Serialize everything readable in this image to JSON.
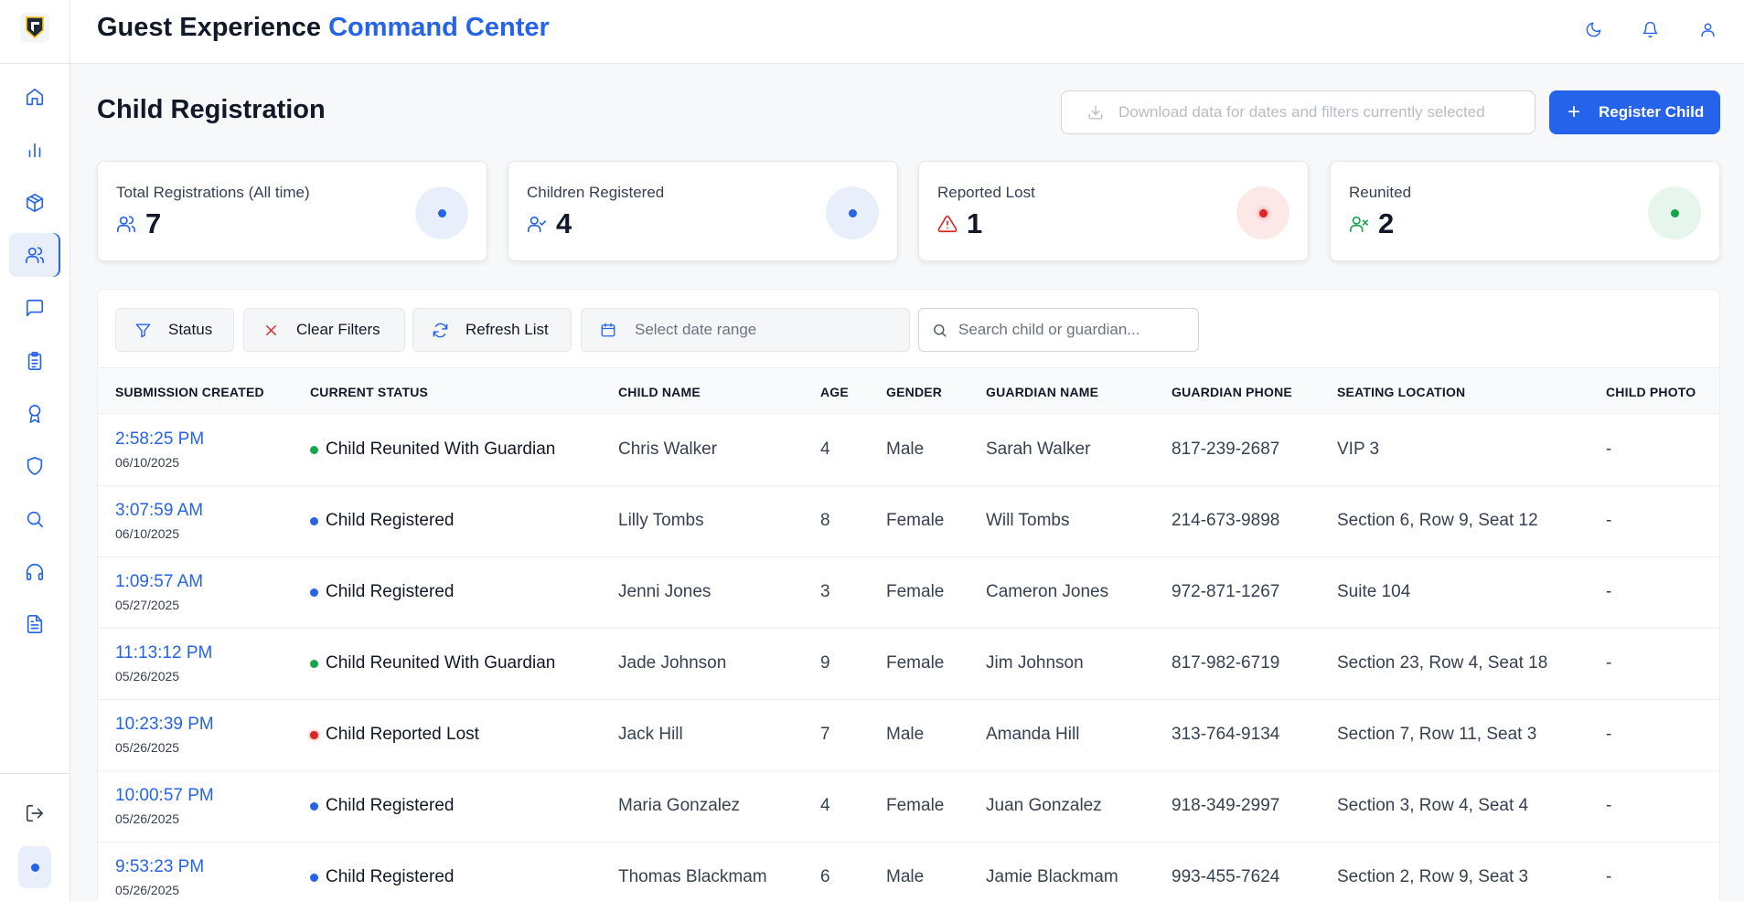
{
  "header": {
    "title_main": "Guest Experience",
    "title_accent": "Command Center"
  },
  "sidebar": {
    "items": [
      {
        "name": "home",
        "icon": "home-icon",
        "active": false
      },
      {
        "name": "analytics",
        "icon": "bar-chart-icon",
        "active": false
      },
      {
        "name": "inventory",
        "icon": "package-icon",
        "active": false
      },
      {
        "name": "guests",
        "icon": "users-icon",
        "active": true
      },
      {
        "name": "messages",
        "icon": "message-icon",
        "active": false
      },
      {
        "name": "tasks",
        "icon": "clipboard-icon",
        "active": false
      },
      {
        "name": "rewards",
        "icon": "award-icon",
        "active": false
      },
      {
        "name": "security",
        "icon": "shield-icon",
        "active": false
      },
      {
        "name": "search",
        "icon": "search-icon",
        "active": false
      },
      {
        "name": "support",
        "icon": "headphones-icon",
        "active": false
      },
      {
        "name": "documents",
        "icon": "file-text-icon",
        "active": false
      }
    ]
  },
  "page": {
    "title": "Child Registration",
    "download_label": "Download data for dates and filters currently selected",
    "register_label": "Register Child"
  },
  "stats": [
    {
      "label": "Total Registrations (All time)",
      "value": "7",
      "color": "#2563eb",
      "bg": "#e8effb"
    },
    {
      "label": "Children Registered",
      "value": "4",
      "color": "#2563eb",
      "bg": "#e8effb"
    },
    {
      "label": "Reported Lost",
      "value": "1",
      "color": "#dc2626",
      "bg": "#fde8e8"
    },
    {
      "label": "Reunited",
      "value": "2",
      "color": "#16a34a",
      "bg": "#e6f6ec"
    }
  ],
  "toolbar": {
    "status_label": "Status",
    "clear_label": "Clear Filters",
    "refresh_label": "Refresh List",
    "date_placeholder": "Select date range",
    "search_placeholder": "Search child or guardian..."
  },
  "table": {
    "columns": [
      "SUBMISSION CREATED",
      "CURRENT STATUS",
      "CHILD NAME",
      "AGE",
      "GENDER",
      "GUARDIAN NAME",
      "GUARDIAN PHONE",
      "SEATING LOCATION",
      "CHILD PHOTO"
    ],
    "rows": [
      {
        "time": "2:58:25 PM",
        "date": "06/10/2025",
        "status": "Child Reunited With Guardian",
        "status_color": "#16a34a",
        "child": "Chris Walker",
        "age": "4",
        "gender": "Male",
        "guardian": "Sarah Walker",
        "phone": "817-239-2687",
        "seat": "VIP 3",
        "photo": "-"
      },
      {
        "time": "3:07:59 AM",
        "date": "06/10/2025",
        "status": "Child Registered",
        "status_color": "#2563eb",
        "child": "Lilly Tombs",
        "age": "8",
        "gender": "Female",
        "guardian": "Will Tombs",
        "phone": "214-673-9898",
        "seat": "Section 6, Row 9, Seat 12",
        "photo": "-"
      },
      {
        "time": "1:09:57 AM",
        "date": "05/27/2025",
        "status": "Child Registered",
        "status_color": "#2563eb",
        "child": "Jenni Jones",
        "age": "3",
        "gender": "Female",
        "guardian": "Cameron Jones",
        "phone": "972-871-1267",
        "seat": "Suite 104",
        "photo": "-"
      },
      {
        "time": "11:13:12 PM",
        "date": "05/26/2025",
        "status": "Child Reunited With Guardian",
        "status_color": "#16a34a",
        "child": "Jade Johnson",
        "age": "9",
        "gender": "Female",
        "guardian": "Jim Johnson",
        "phone": "817-982-6719",
        "seat": "Section 23, Row 4, Seat 18",
        "photo": "-"
      },
      {
        "time": "10:23:39 PM",
        "date": "05/26/2025",
        "status": "Child Reported Lost",
        "status_color": "#dc2626",
        "child": "Jack Hill",
        "age": "7",
        "gender": "Male",
        "guardian": "Amanda Hill",
        "phone": "313-764-9134",
        "seat": "Section 7, Row 11, Seat 3",
        "photo": "-"
      },
      {
        "time": "10:00:57 PM",
        "date": "05/26/2025",
        "status": "Child Registered",
        "status_color": "#2563eb",
        "child": "Maria Gonzalez",
        "age": "4",
        "gender": "Female",
        "guardian": "Juan Gonzalez",
        "phone": "918-349-2997",
        "seat": "Section 3, Row 4, Seat 4",
        "photo": "-"
      },
      {
        "time": "9:53:23 PM",
        "date": "05/26/2025",
        "status": "Child Registered",
        "status_color": "#2563eb",
        "child": "Thomas Blackmam",
        "age": "6",
        "gender": "Male",
        "guardian": "Jamie Blackmam",
        "phone": "993-455-7624",
        "seat": "Section 2, Row 9, Seat 3",
        "photo": "-"
      }
    ]
  }
}
